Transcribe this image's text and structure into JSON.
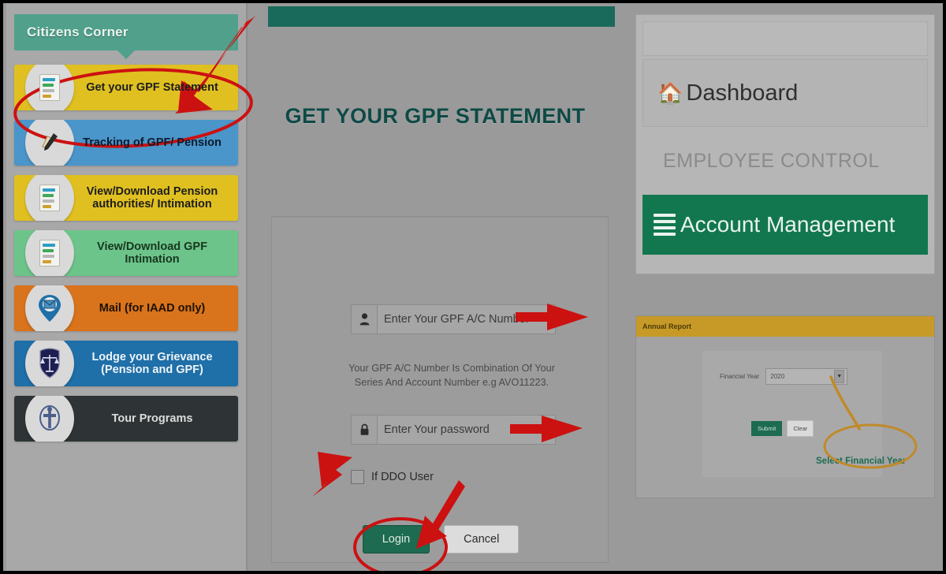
{
  "window": {
    "title": "Get your GPF Statement"
  },
  "sidebar": {
    "header": "Citizens Corner",
    "items": [
      {
        "label": "Get your GPF Statement",
        "icon": "document-icon",
        "color": "#e0c020"
      },
      {
        "label": "Tracking of GPF/ Pension",
        "icon": "hand-write-icon",
        "color": "#4a95c9"
      },
      {
        "label": "View/Download  Pension\nauthorities/ Intimation",
        "icon": "document-icon",
        "color": "#e0c020"
      },
      {
        "label": "View/Download GPF\nIntimation",
        "icon": "document-icon",
        "color": "#6dc48a"
      },
      {
        "label": "Mail  (for IAAD only)",
        "icon": "mail-pin-icon",
        "color": "#d9731c"
      },
      {
        "label": "Lodge your Grievance\n(Pension and GPF)",
        "icon": "justice-shield-icon",
        "color": "#1f6fa8"
      },
      {
        "label": "Tour Programs",
        "icon": "emblem-icon",
        "color": "#2e3436"
      }
    ]
  },
  "main": {
    "page_title": "GET YOUR GPF STATEMENT",
    "account_field": {
      "placeholder": "Enter Your GPF A/C Number",
      "value": "",
      "icon": "user-icon"
    },
    "hint": "Your GPF A/C Number Is Combination Of Your Series And Account Number e.g AVO11223.",
    "password_field": {
      "placeholder": "Enter Your password",
      "value": "",
      "icon": "lock-icon"
    },
    "ddo_checkbox": {
      "label": "If DDO User",
      "checked": false
    },
    "login_button": "Login",
    "cancel_button": "Cancel"
  },
  "right_panel": {
    "nav": {
      "dashboard": "Dashboard",
      "dashboard_icon": "home-icon",
      "section_label": "EMPLOYEE CONTROL",
      "active_item": "Account Management",
      "active_icon": "hamburger-icon",
      "active_color": "#12774f"
    },
    "report": {
      "header": "Annual Report",
      "financial_year_label": "Financial Year",
      "financial_year_value": "2020",
      "submit_button": "Submit",
      "clear_button": "Clear",
      "annotation": "Select Financial Year",
      "header_color": "#c79a28",
      "annotation_color": "#1d6b50"
    }
  },
  "annotations": {
    "arrow_color": "#cc1111",
    "ellipse_color": "#cc1111",
    "report_highlight_color": "#c08a2a",
    "items": [
      "arrow-to-gpf-statement",
      "ellipse-around-gpf-statement",
      "arrow-to-account-field",
      "arrow-to-password-field",
      "arrow-to-ddo-checkbox",
      "arrow-to-login-button",
      "ellipse-around-login-button",
      "ellipse-around-select-financial-year",
      "pointer-line-to-year-dropdown"
    ]
  }
}
